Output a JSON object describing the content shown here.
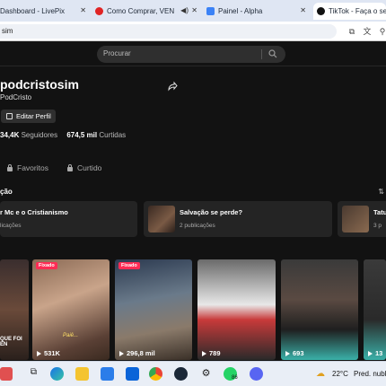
{
  "browser": {
    "tabs": [
      {
        "title": "Dashboard - LivePix"
      },
      {
        "title": "Como Comprar, VEN"
      },
      {
        "title": "Painel - Alpha"
      },
      {
        "title": "TikTok - Faça o seu d"
      }
    ],
    "address": "sim"
  },
  "search": {
    "placeholder": "Procurar"
  },
  "profile": {
    "username": "podcristosim",
    "nickname": "PodCristo",
    "edit_label": "Editar Perfil",
    "followers_value": "34,4K",
    "followers_label": "Seguidores",
    "likes_value": "674,5 mil",
    "likes_label": "Curtidas"
  },
  "profile_tabs": {
    "favorites": "Favoritos",
    "liked": "Curtido"
  },
  "section": {
    "title": "ção",
    "arrow": "⇅"
  },
  "playlists": [
    {
      "title": "r Mc e o Cristianismo",
      "sub": "licações"
    },
    {
      "title": "Salvação se perde?",
      "sub": "2 publicações"
    },
    {
      "title": "Tatu",
      "sub": "3 p"
    }
  ],
  "videos": [
    {
      "views": "",
      "overlay": "QUE FOI EN",
      "pinned": false
    },
    {
      "views": "531K",
      "overlay": "Paiê...",
      "pinned": true,
      "pin_label": "Fixado"
    },
    {
      "views": "296,8 mil",
      "overlay": "",
      "pinned": true,
      "pin_label": "Fixado"
    },
    {
      "views": "789",
      "overlay": "",
      "pinned": false
    },
    {
      "views": "693",
      "overlay": "",
      "pinned": false
    },
    {
      "views": "13",
      "overlay": "",
      "pinned": false
    }
  ],
  "taskbar": {
    "weather": "22°C",
    "weather_desc": "Pred. nubla",
    "whatsapp_badge": "86"
  }
}
